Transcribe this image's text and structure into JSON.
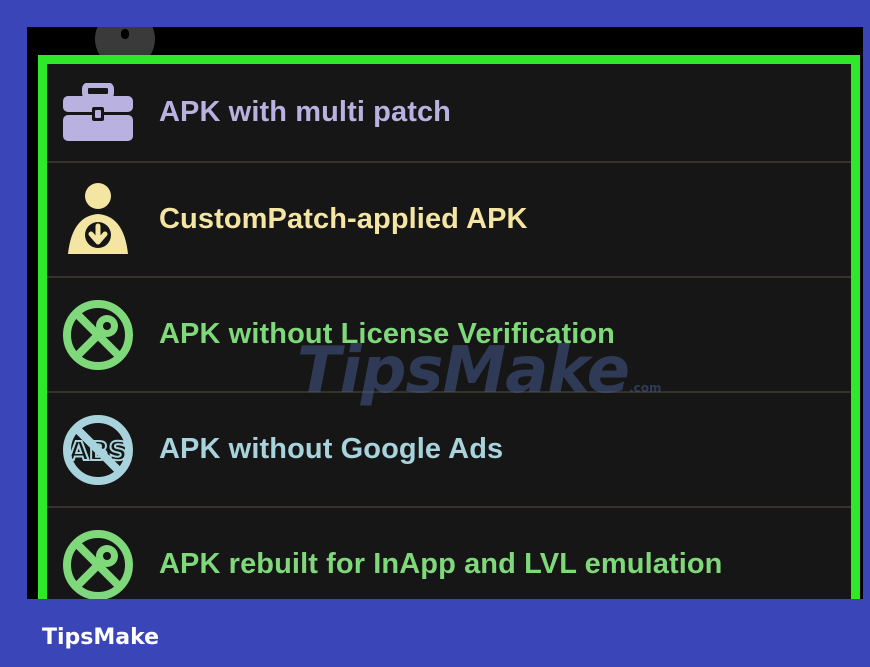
{
  "colors": {
    "frame": "#3a46b8",
    "highlight_border": "#2ee82a",
    "list_background": "#161616",
    "divider": "#34322a"
  },
  "menu": {
    "items": [
      {
        "label": "APK with multi patch",
        "icon": "toolbox-icon",
        "color": "#b9b2e0"
      },
      {
        "label": "CustomPatch-applied APK",
        "icon": "user-download-icon",
        "color": "#f4e5a2"
      },
      {
        "label": "APK without License Verification",
        "icon": "no-key-icon",
        "color": "#7fd87a"
      },
      {
        "label": "APK without Google Ads",
        "icon": "no-ads-icon",
        "color": "#a9d3dc"
      },
      {
        "label": "APK rebuilt for InApp and LVL emulation",
        "icon": "no-key-icon",
        "color": "#7fd87a"
      }
    ]
  },
  "watermark": {
    "text": "TipsMake",
    "suffix": ".com"
  },
  "footer": {
    "brand": "TipsMake"
  }
}
